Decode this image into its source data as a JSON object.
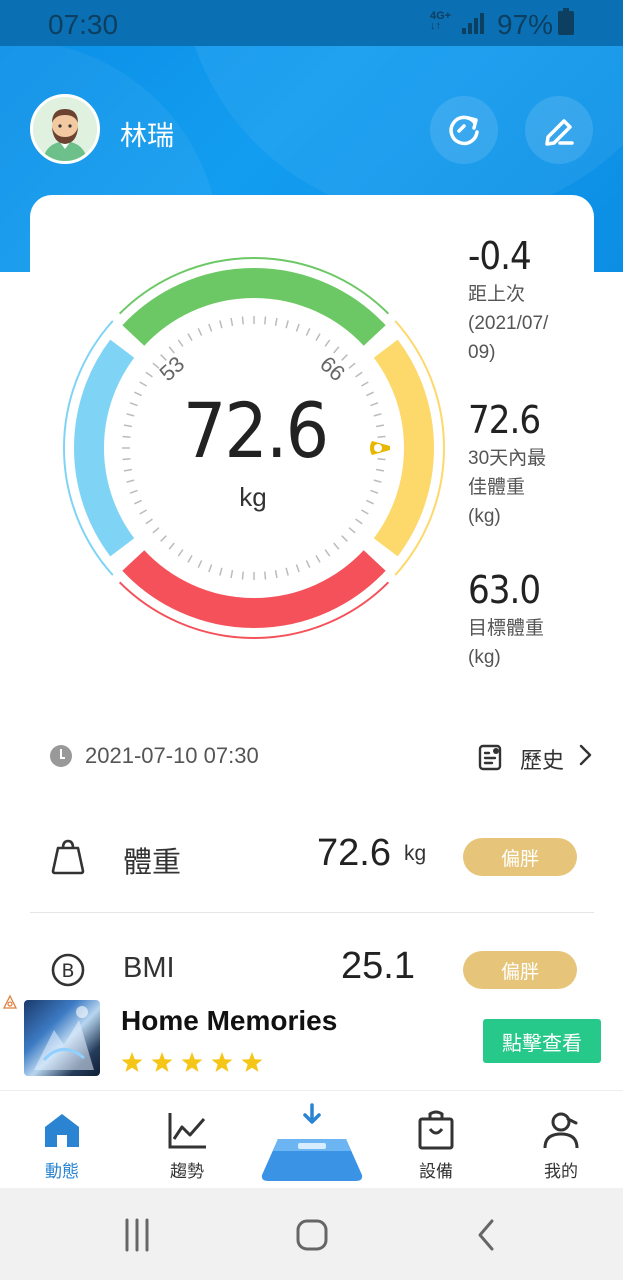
{
  "status_bar": {
    "time": "07:30",
    "network": "4G+",
    "battery": "97%"
  },
  "header": {
    "user_name": "林瑞",
    "avatar_icon": "bearded-man-avatar",
    "sync_icon": "refresh-icon",
    "edit_icon": "edit-pencil-icon"
  },
  "gauge": {
    "value": "72.6",
    "unit": "kg",
    "tick_low": "53",
    "tick_high": "66",
    "pointer_fraction": 0.5,
    "colors": {
      "underweight": "#7fd4f5",
      "normal": "#6cc864",
      "overweight": "#fdd86b",
      "obese": "#f4515a",
      "pointer": "#e8b800"
    }
  },
  "side_stats": [
    {
      "value": "-0.4",
      "label_lines": [
        "距上次",
        "(2021/07/",
        "09)"
      ]
    },
    {
      "value": "72.6",
      "label_lines": [
        "30天內最",
        "佳體重",
        "(kg)"
      ]
    },
    {
      "value": "63.0",
      "label_lines": [
        "目標體重",
        "(kg)"
      ]
    }
  ],
  "record": {
    "timestamp": "2021-07-10 07:30",
    "history_label": "歷史"
  },
  "metrics": [
    {
      "name": "體重",
      "value": "72.6",
      "unit": "kg",
      "badge": "偏胖",
      "icon": "weight-icon"
    },
    {
      "name": "BMI",
      "value": "25.1",
      "unit": "",
      "badge": "偏胖",
      "icon": "bmi-icon"
    }
  ],
  "ad": {
    "title": "Home Memories",
    "stars": 5,
    "button": "點擊查看",
    "ad_icon": "ad-choices-icon"
  },
  "tabs": [
    {
      "label": "動態",
      "icon": "home-icon",
      "active": true
    },
    {
      "label": "趨勢",
      "icon": "trend-chart-icon",
      "active": false
    },
    {
      "label": "",
      "icon": "scale-icon",
      "active": false
    },
    {
      "label": "設備",
      "icon": "device-bag-icon",
      "active": false
    },
    {
      "label": "我的",
      "icon": "profile-icon",
      "active": false
    }
  ],
  "nav": {
    "recent_icon": "recent-apps-icon",
    "home_icon": "home-circle-icon",
    "back_icon": "back-icon"
  }
}
